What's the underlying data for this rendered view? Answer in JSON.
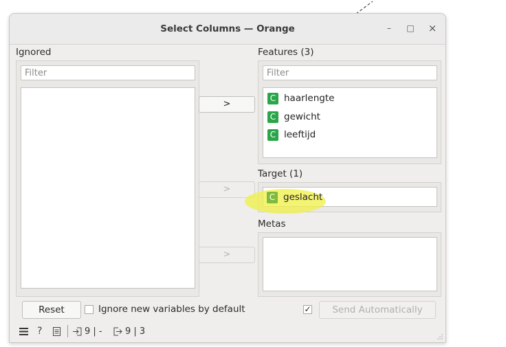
{
  "window": {
    "title": "Select Columns — Orange",
    "minimize_glyph": "–",
    "maximize_glyph": "□",
    "close_glyph": "×"
  },
  "ignored": {
    "label": "Ignored",
    "filter_placeholder": "Filter"
  },
  "features": {
    "label": "Features (3)",
    "filter_placeholder": "Filter",
    "items": [
      {
        "badge": "C",
        "name": "haarlengte"
      },
      {
        "badge": "C",
        "name": "gewicht"
      },
      {
        "badge": "C",
        "name": "leeftijd"
      }
    ]
  },
  "target": {
    "label": "Target (1)",
    "items": [
      {
        "badge": "C",
        "name": "geslacht"
      }
    ]
  },
  "metas": {
    "label": "Metas"
  },
  "move_buttons": {
    "features": ">",
    "target": ">",
    "metas": ">"
  },
  "footer": {
    "reset_label": "Reset",
    "ignore_new_label": "Ignore new variables by default",
    "ignore_new_checked": false,
    "send_auto_checked": true,
    "send_auto_label": "Send Automatically"
  },
  "status": {
    "input_summary": "9 | -",
    "output_summary": "9 | 3",
    "menu_icon": "hamburger-menu-icon",
    "help_icon": "help-icon",
    "report_icon": "report-icon",
    "input_icon": "input-icon",
    "output_icon": "output-icon"
  },
  "colors": {
    "badge_continuous": "#2aa54a",
    "highlight": "#f0f046"
  }
}
